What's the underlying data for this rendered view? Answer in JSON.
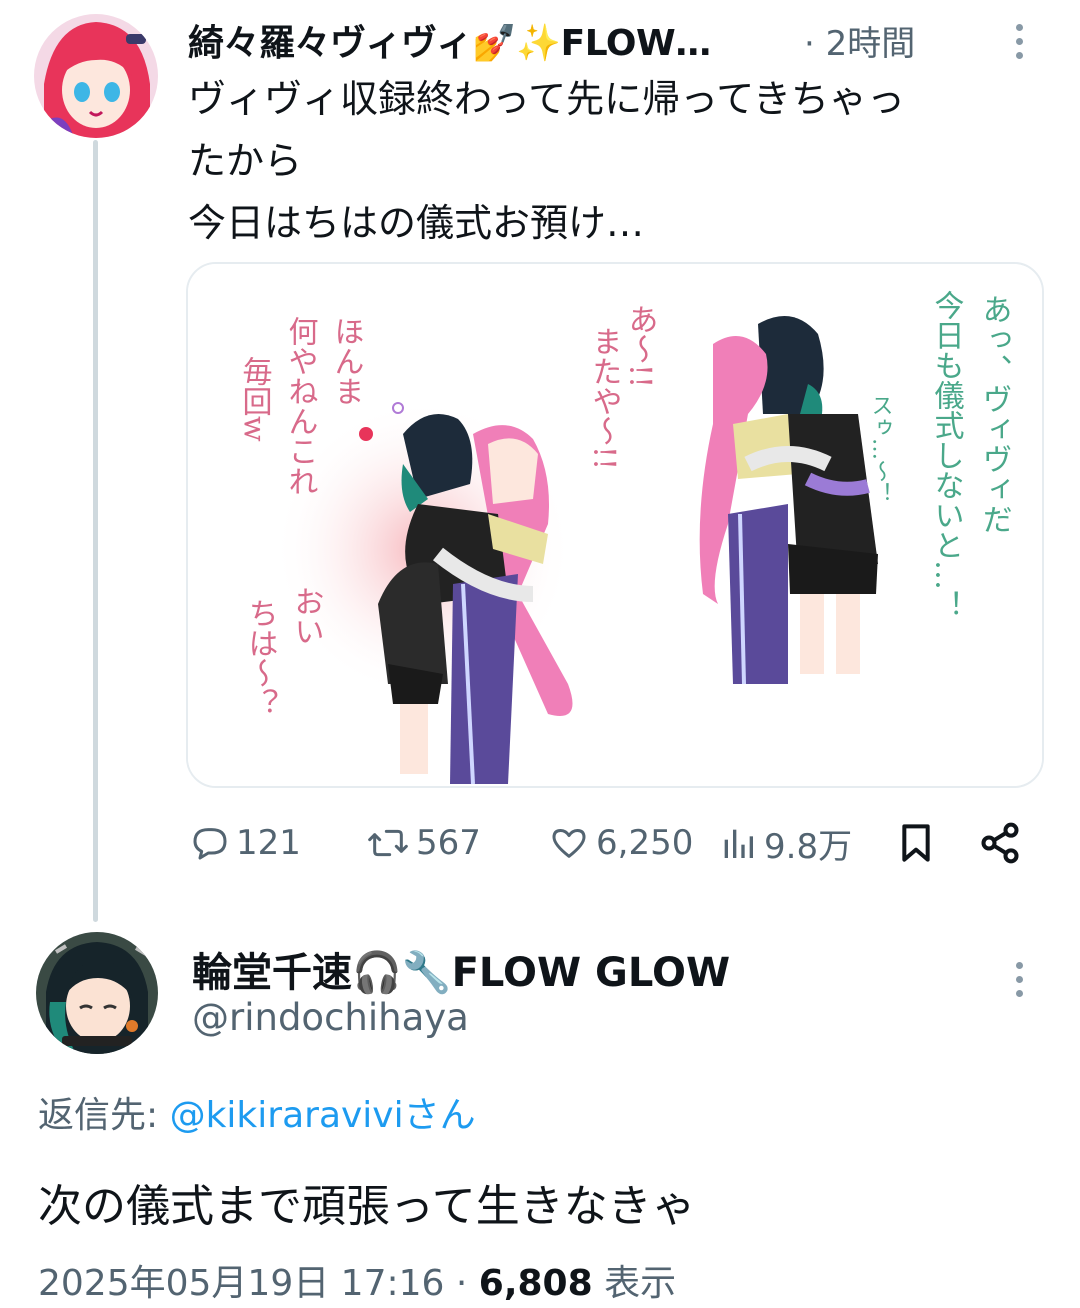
{
  "tweet1": {
    "author_name": "綺々羅々ヴィヴィ💅✨FLOW…",
    "time": "· 2時間",
    "text_lines": [
      "ヴィヴィ収録終わって先に帰ってきちゃっ",
      "たから",
      "今日はちはの儀式お預け…"
    ],
    "image_handwriting": {
      "left_col1": "ほんま",
      "left_col2": "何やねんこれ",
      "left_col3": "毎回w",
      "left_bottom1": "おい",
      "left_bottom2": "ちは〜？",
      "mid_col1": "あ〜!!",
      "mid_col2": "またや〜!!",
      "right_col1": "あっ、ヴィヴィだ",
      "right_col2": "今日も儀式しないと…！",
      "right_small": "スゥ…〜！"
    },
    "actions": {
      "replies": "121",
      "retweets": "567",
      "likes": "6,250",
      "views": "9.8万"
    }
  },
  "tweet2": {
    "author_name": "輪堂千速🎧🔧FLOW GLOW",
    "handle": "@rindochihaya",
    "reply_prefix": "返信先: ",
    "reply_mention": "@kikiraraviviさん",
    "text": "次の儀式まで頑張って生きなきゃ",
    "datetime": "2025年05月19日 17:16 · ",
    "views_count": "6,808",
    "views_label": " 表示"
  },
  "colors": {
    "accent": "#1d9bf0",
    "muted": "#536471",
    "thread_line": "#cfd9de",
    "text": "#0f1419"
  }
}
